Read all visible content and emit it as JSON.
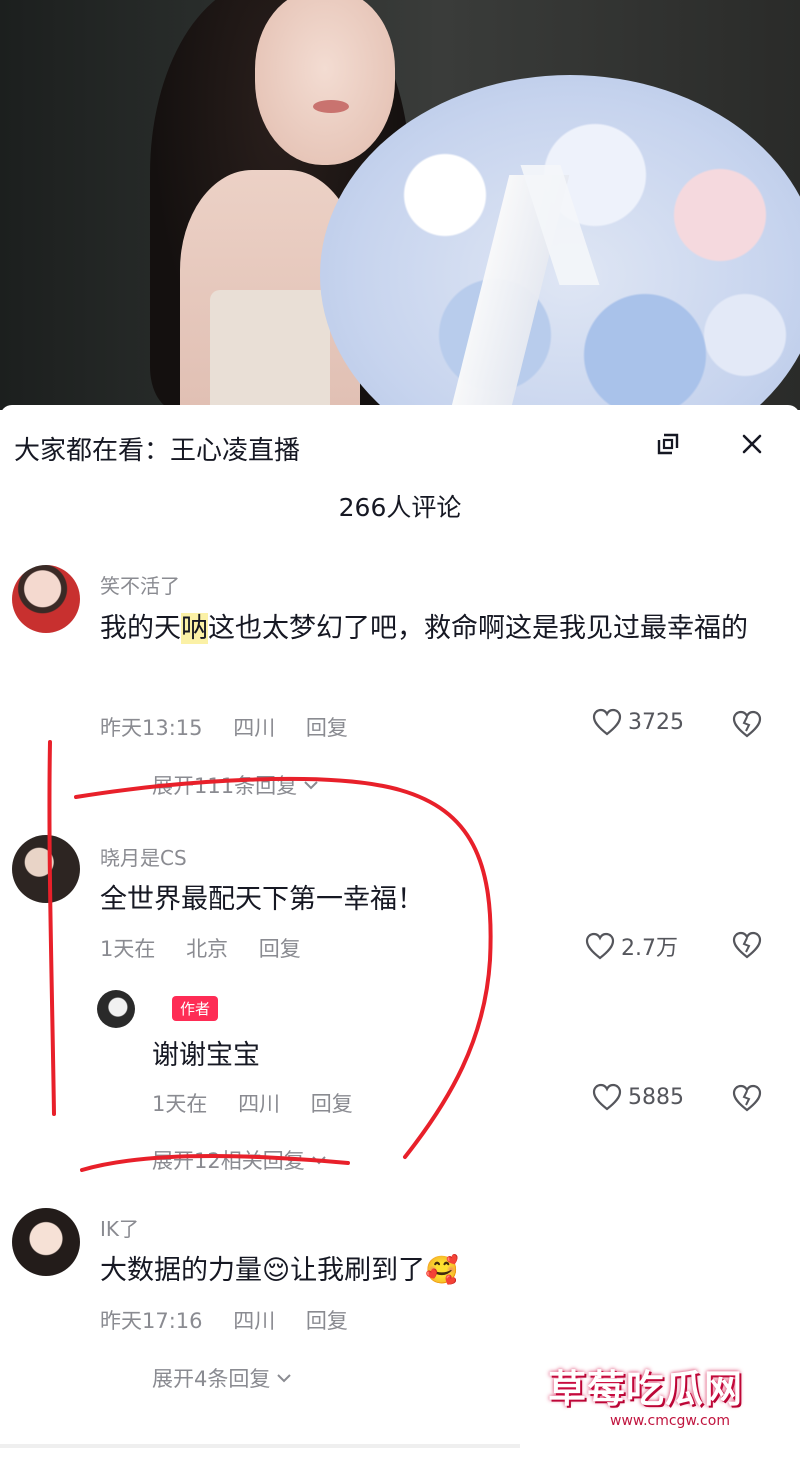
{
  "header": {
    "title": "大家都在看：王心凌直播",
    "comment_count": "266人评论"
  },
  "comments": [
    {
      "username": "笑不活了",
      "text_pre": "我的天",
      "text_highlight": "呐",
      "text_post": "这也太梦幻了吧，救命啊这是我见过最幸福的",
      "time": "昨天13:15",
      "location": "四川",
      "reply_label": "回复",
      "likes": "3725",
      "expand": "展开111条回复"
    },
    {
      "username": "晓月是CS",
      "text": "全世界最配天下第一幸福！",
      "time": "1天在",
      "location": "北京",
      "reply_label": "回复",
      "likes": "2.7万",
      "reply": {
        "tag": "作者",
        "text": "谢谢宝宝",
        "time": "1天在",
        "location": "四川",
        "reply_label": "回复",
        "likes": "5885"
      },
      "expand": "展开12相关回复"
    },
    {
      "username": "IK了",
      "text": "大数据的力量😌让我刷到了🥰",
      "time": "昨天17:16",
      "location": "四川",
      "reply_label": "回复",
      "expand": "展开4条回复"
    }
  ],
  "watermark": {
    "title": "草莓吃瓜网",
    "url": "www.cmcgw.com"
  },
  "colors": {
    "accent": "#fe2c55",
    "annotation": "#e8202a",
    "meta": "#8a8b91",
    "text": "#161823"
  }
}
